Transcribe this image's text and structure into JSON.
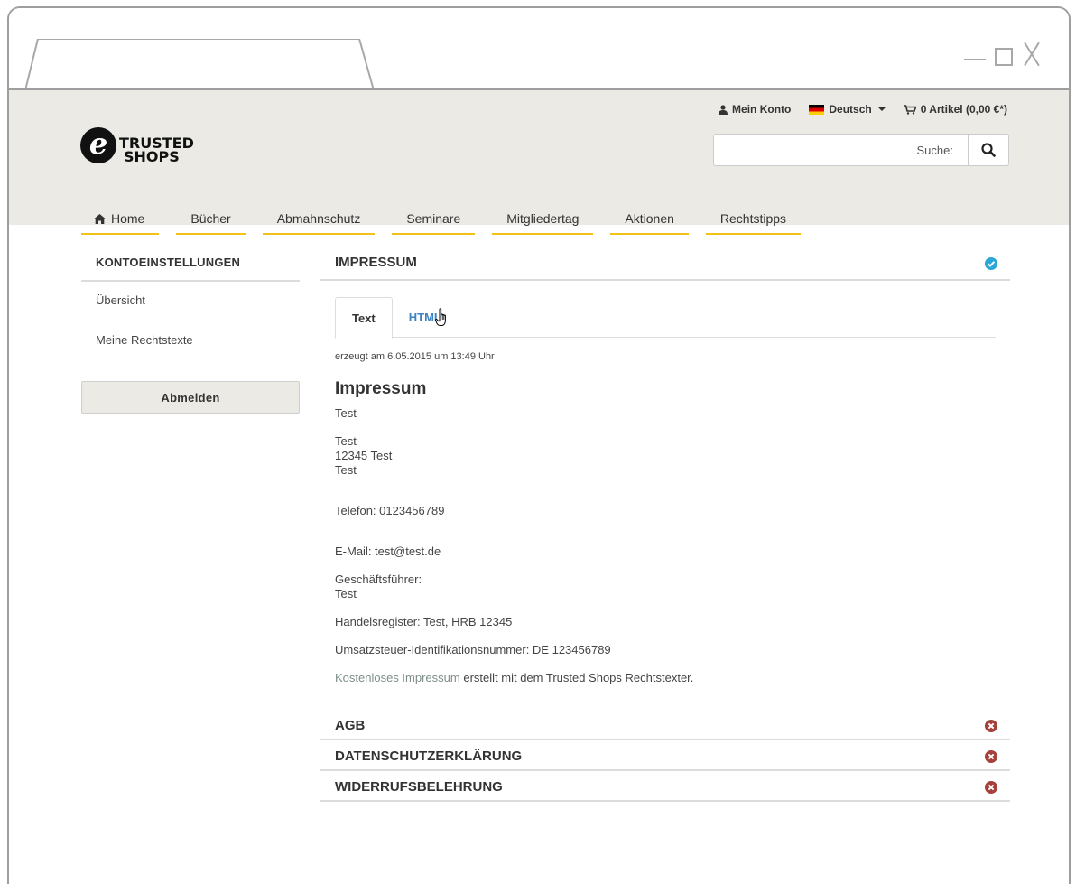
{
  "header": {
    "logo": {
      "line1": "TRUSTED",
      "line2": "SHOPS"
    },
    "account_label": "Mein Konto",
    "language_label": "Deutsch",
    "cart_label": "0 Artikel (0,00 €*)",
    "search_placeholder": "Suche:"
  },
  "nav": {
    "items": [
      {
        "label": "Home"
      },
      {
        "label": "Bücher"
      },
      {
        "label": "Abmahnschutz"
      },
      {
        "label": "Seminare"
      },
      {
        "label": "Mitgliedertag"
      },
      {
        "label": "Aktionen"
      },
      {
        "label": "Rechtstipps"
      }
    ]
  },
  "sidebar": {
    "title": "KONTOEINSTELLUNGEN",
    "items": [
      {
        "label": "Übersicht"
      },
      {
        "label": "Meine Rechtstexte"
      }
    ],
    "logout_label": "Abmelden"
  },
  "main": {
    "impressum_section": {
      "title": "IMPRESSUM",
      "tabs": [
        {
          "label": "Text"
        },
        {
          "label": "HTML"
        }
      ],
      "generated_note": "erzeugt am 6.05.2015 um 13:49 Uhr",
      "doc": {
        "heading": "Impressum",
        "name": "Test",
        "address": [
          "Test",
          "12345 Test",
          "Test"
        ],
        "phone": "Telefon: 0123456789",
        "email": "E-Mail: test@test.de",
        "ceo_label": "Geschäftsführer:",
        "ceo_name": "Test",
        "register": "Handelsregister: Test, HRB 12345",
        "vat": "Umsatzsteuer-Identifikationsnummer: DE 123456789",
        "footer_link": "Kostenloses Impressum",
        "footer_text": " erstellt mit dem Trusted Shops Rechtstexter."
      }
    },
    "other_sections": [
      {
        "title": "AGB"
      },
      {
        "title": "DATENSCHUTZERKLÄRUNG"
      },
      {
        "title": "WIDERRUFSBELEHRUNG"
      }
    ]
  },
  "colors": {
    "header_bg": "#ebeae4",
    "nav_underline": "#f2c21b",
    "tab_link": "#3b82c4",
    "status_ok": "#2aa7d6",
    "status_error": "#a3413a"
  },
  "icons": {
    "account": "user-icon",
    "language": "flag-de-icon",
    "cart": "cart-icon",
    "search": "search-icon",
    "home": "home-icon",
    "impressum_status": "check-circle-icon",
    "other_status": "x-circle-icon"
  }
}
